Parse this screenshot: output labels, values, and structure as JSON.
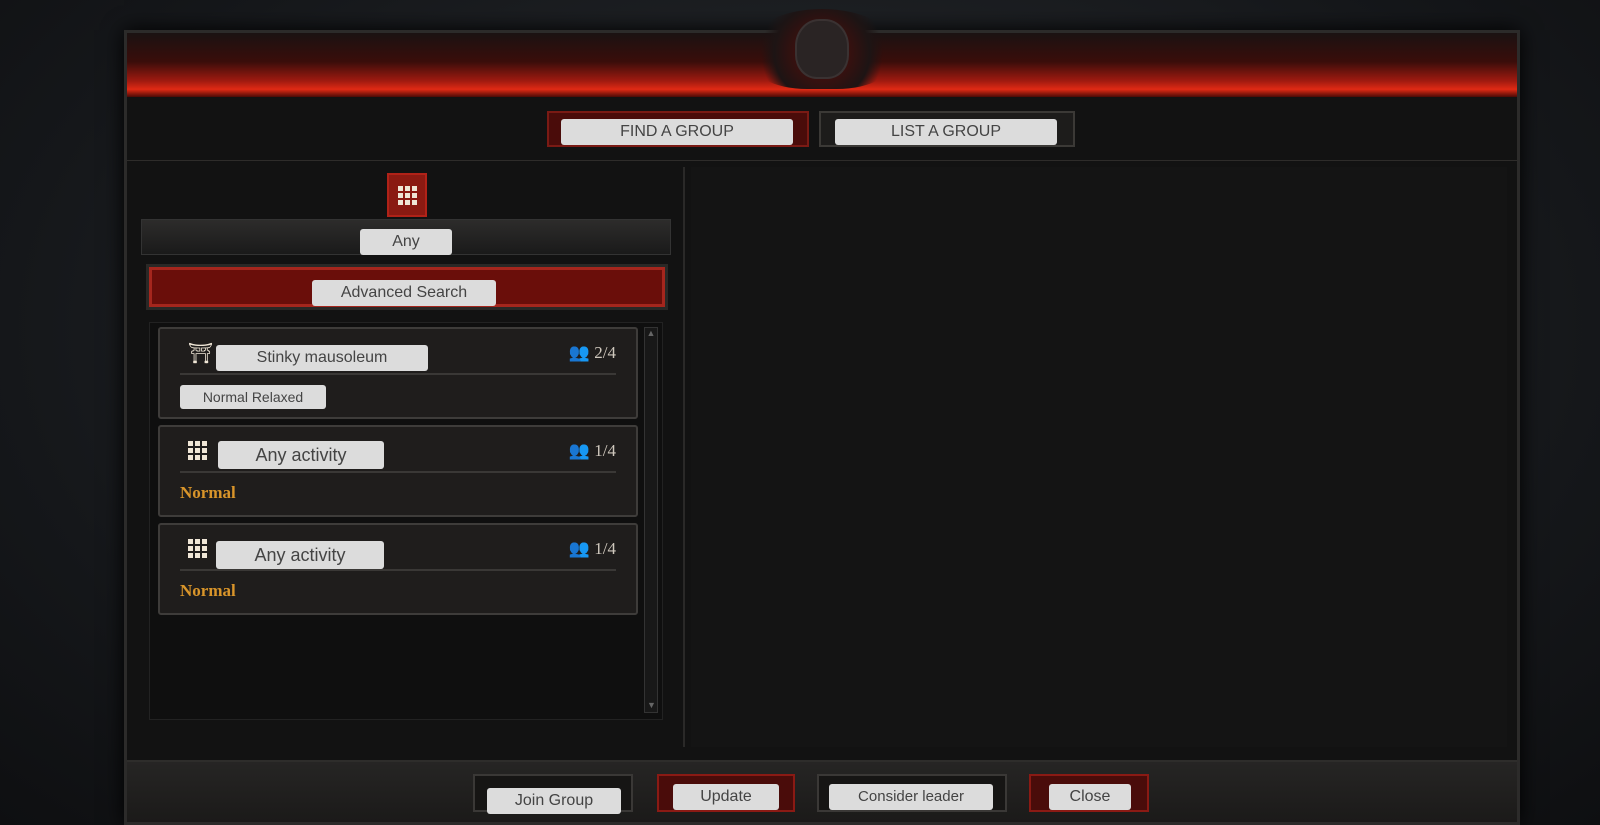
{
  "tabs": [
    {
      "label": "FIND A GROUP",
      "active": true
    },
    {
      "label": "LIST A GROUP",
      "active": false
    }
  ],
  "filter": {
    "activity_icon": "grid-icon",
    "activity_value": "Any",
    "advanced_search_label": "Advanced Search"
  },
  "groups": [
    {
      "icon": "gate-icon",
      "title": "Stinky mausoleum",
      "members": "2/4",
      "difficulty": "Normal Relaxed"
    },
    {
      "icon": "grid-icon",
      "title": "Any activity",
      "members": "1/4",
      "difficulty": "Normal"
    },
    {
      "icon": "grid-icon",
      "title": "Any activity",
      "members": "1/4",
      "difficulty": "Normal"
    }
  ],
  "footer": {
    "join": "Join Group",
    "update": "Update",
    "consider": "Consider leader",
    "close": "Close"
  },
  "colors": {
    "accent_red": "#a5261d",
    "difficulty_gold": "#d9952a"
  }
}
